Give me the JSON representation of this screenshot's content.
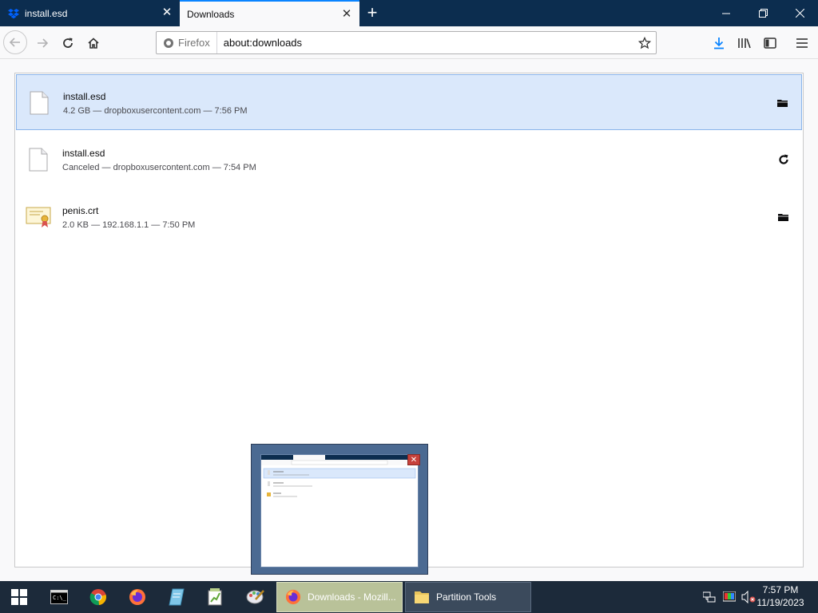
{
  "browser": {
    "tabs": [
      {
        "label": "install.esd",
        "active": false
      },
      {
        "label": "Downloads",
        "active": true
      }
    ],
    "identity_label": "Firefox",
    "url": "about:downloads"
  },
  "downloads": [
    {
      "name": "install.esd",
      "status": "4.2 GB — dropboxusercontent.com — 7:56 PM",
      "icon": "document-icon",
      "action": "folder-icon",
      "selected": true
    },
    {
      "name": "install.esd",
      "status": "Canceled — dropboxusercontent.com — 7:54 PM",
      "icon": "document-icon",
      "action": "retry-icon",
      "selected": false
    },
    {
      "name": "penis.crt",
      "status": "2.0 KB — 192.168.1.1 — 7:50 PM",
      "icon": "certificate-icon",
      "action": "folder-icon",
      "selected": false
    }
  ],
  "taskbar": {
    "tasks": [
      {
        "label": "Downloads - Mozill...",
        "icon": "firefox-icon"
      },
      {
        "label": "Partition Tools",
        "icon": "folder-icon"
      }
    ],
    "time": "7:57 PM",
    "date": "11/19/2023"
  },
  "colors": {
    "tabstrip": "#0c2d4f",
    "accent": "#0a84ff",
    "selected_row": "#dae8fb"
  }
}
